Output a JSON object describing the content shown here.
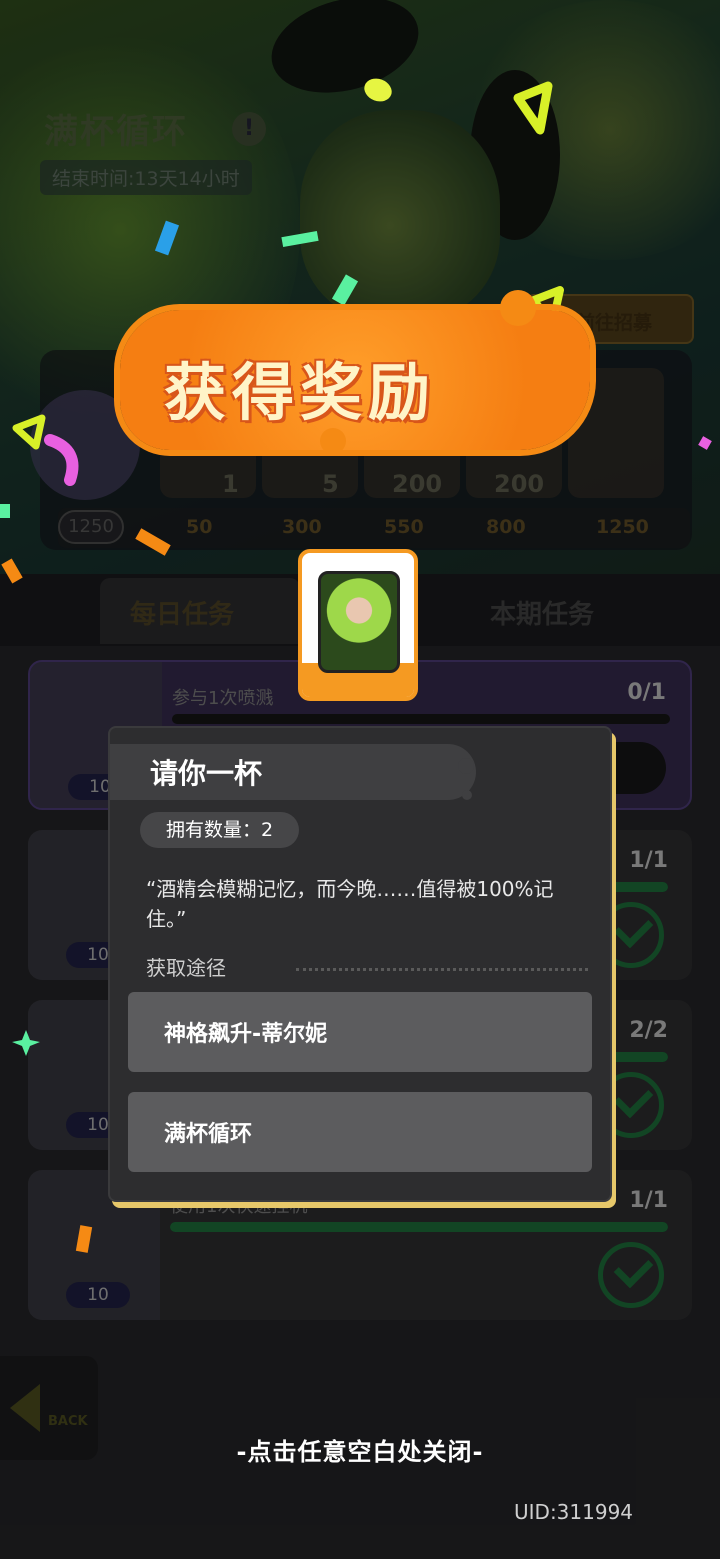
{
  "event": {
    "title": "满杯循环",
    "info_icon": "!",
    "end_time": "结束时间:13天14小时",
    "recruit_label": "前往招募"
  },
  "track": {
    "current_points": "1250",
    "slots": [
      {
        "qty": "1",
        "threshold": "50"
      },
      {
        "qty": "5",
        "threshold": "300"
      },
      {
        "qty": "200",
        "threshold": "550"
      },
      {
        "qty": "200",
        "threshold": "800"
      },
      {
        "qty": "",
        "threshold": "1250"
      }
    ]
  },
  "tabs": {
    "daily": "每日任务",
    "period": "本期任务"
  },
  "tasks": [
    {
      "name": "参与1次喷溅",
      "progress": "0/1",
      "fill": 0.0,
      "reward": "10",
      "done": false
    },
    {
      "name": "",
      "progress": "1/1",
      "fill": 1.0,
      "reward": "10",
      "done": true
    },
    {
      "name": "",
      "progress": "2/2",
      "fill": 1.0,
      "reward": "10",
      "done": true
    },
    {
      "name": "使用1次快速挂机",
      "progress": "1/1",
      "fill": 1.0,
      "reward": "10",
      "done": true
    }
  ],
  "back_label": "BACK",
  "reward_banner": "获得奖励",
  "item_dialog": {
    "title": "请你一杯",
    "owned": "拥有数量：2",
    "quote": "“酒精会模糊记忆，而今晚……值得被100%记住。”",
    "source_label": "获取途径",
    "sources": [
      "神格飙升-蒂尔妮",
      "满杯循环"
    ]
  },
  "close_hint": "-点击任意空白处关闭-",
  "uid": "UID:311994",
  "colors": {
    "accent_orange": "#f58a14",
    "dialog_bg": "#2d2d2f",
    "dialog_shadow": "#e7c86a",
    "check_green": "#1d6a38"
  }
}
